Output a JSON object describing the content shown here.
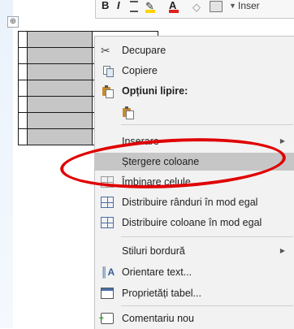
{
  "mini_toolbar": {
    "bold": "B",
    "italic": "I",
    "font_color": "A",
    "insert_label": "Inser"
  },
  "table_handle": "⊕",
  "context_menu": {
    "items": [
      {
        "label": "Decupare",
        "icon": "scissors-icon"
      },
      {
        "label": "Copiere",
        "icon": "copy-icon"
      },
      {
        "label": "Opțiuni lipire:",
        "icon": "clipboard-icon"
      },
      {
        "label": "",
        "icon": "paste-keep-format-icon"
      },
      {
        "label": "Inserare",
        "icon": "",
        "submenu": true
      },
      {
        "label": "Ștergere coloane",
        "icon": "",
        "highlighted": true
      },
      {
        "label": "Îmbinare celule",
        "icon": "merge-cells-icon"
      },
      {
        "label": "Distribuire rânduri în mod egal",
        "icon": "distribute-rows-icon"
      },
      {
        "label": "Distribuire coloane în mod egal",
        "icon": "distribute-columns-icon"
      },
      {
        "label": "Stiluri bordură",
        "icon": "",
        "submenu": true
      },
      {
        "label": "Orientare text...",
        "icon": "text-direction-icon"
      },
      {
        "label": "Proprietăți tabel...",
        "icon": "table-properties-icon"
      },
      {
        "label": "Comentariu nou",
        "icon": "new-comment-icon"
      }
    ]
  },
  "colors": {
    "highlight": "#c6c6c6",
    "annotation": "#e00000",
    "menu_bg": "#f2f2f2",
    "selected_cell": "#c6c6c6"
  }
}
